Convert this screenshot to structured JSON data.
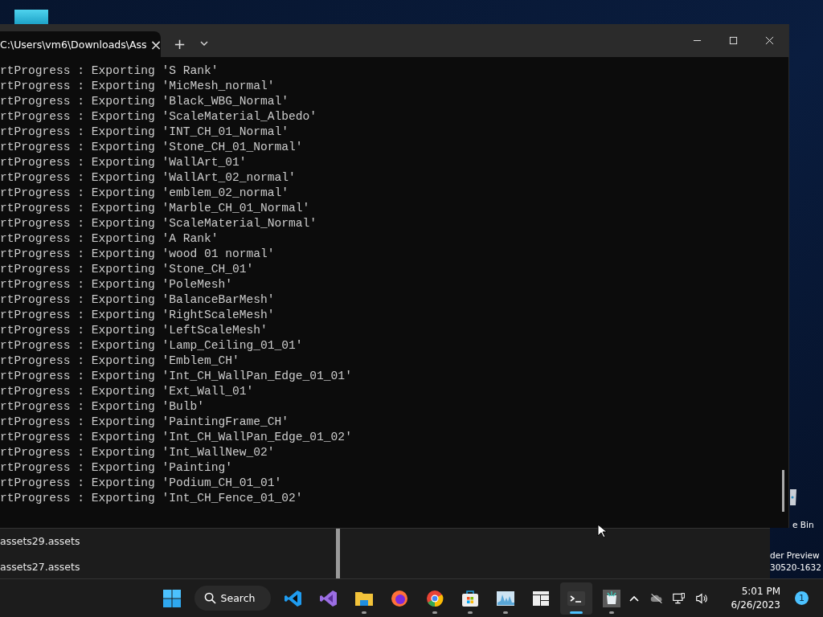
{
  "desktop": {
    "labels": [
      {
        "text": "e Bin"
      },
      {
        "text": "der Preview"
      },
      {
        "text": "30520-1632"
      }
    ]
  },
  "terminal": {
    "tab": {
      "title": "C:\\Users\\vm6\\Downloads\\Ass",
      "close": "×"
    },
    "new_tab": "+",
    "lines": [
      "rtProgress : Exporting 'S Rank'",
      "rtProgress : Exporting 'MicMesh_normal'",
      "rtProgress : Exporting 'Black_WBG_Normal'",
      "rtProgress : Exporting 'ScaleMaterial_Albedo'",
      "rtProgress : Exporting 'INT_CH_01_Normal'",
      "rtProgress : Exporting 'Stone_CH_01_Normal'",
      "rtProgress : Exporting 'WallArt_01'",
      "rtProgress : Exporting 'WallArt_02_normal'",
      "rtProgress : Exporting 'emblem_02_normal'",
      "rtProgress : Exporting 'Marble_CH_01_Normal'",
      "rtProgress : Exporting 'ScaleMaterial_Normal'",
      "rtProgress : Exporting 'A Rank'",
      "rtProgress : Exporting 'wood 01 normal'",
      "rtProgress : Exporting 'Stone_CH_01'",
      "rtProgress : Exporting 'PoleMesh'",
      "rtProgress : Exporting 'BalanceBarMesh'",
      "rtProgress : Exporting 'RightScaleMesh'",
      "rtProgress : Exporting 'LeftScaleMesh'",
      "rtProgress : Exporting 'Lamp_Ceiling_01_01'",
      "rtProgress : Exporting 'Emblem_CH'",
      "rtProgress : Exporting 'Int_CH_WallPan_Edge_01_01'",
      "rtProgress : Exporting 'Ext_Wall_01'",
      "rtProgress : Exporting 'Bulb'",
      "rtProgress : Exporting 'PaintingFrame_CH'",
      "rtProgress : Exporting 'Int_CH_WallPan_Edge_01_02'",
      "rtProgress : Exporting 'Int_WallNew_02'",
      "rtProgress : Exporting 'Painting'",
      "rtProgress : Exporting 'Podium_CH_01_01'",
      "rtProgress : Exporting 'Int_CH_Fence_01_02'"
    ]
  },
  "explorer": {
    "files": [
      "assets29.assets",
      "assets27.assets"
    ]
  },
  "taskbar": {
    "search": "Search",
    "apps": [
      {
        "kind": "vscode",
        "running": false,
        "selected": false
      },
      {
        "kind": "studio",
        "running": false,
        "selected": false
      },
      {
        "kind": "folder",
        "running": true,
        "selected": false
      },
      {
        "kind": "firefox",
        "running": false,
        "selected": false
      },
      {
        "kind": "chrome",
        "running": true,
        "selected": false
      },
      {
        "kind": "store",
        "running": true,
        "selected": false
      },
      {
        "kind": "monitor",
        "running": true,
        "selected": false
      },
      {
        "kind": "snap",
        "running": false,
        "selected": false
      },
      {
        "kind": "terminal",
        "running": true,
        "selected": true
      },
      {
        "kind": "package",
        "running": true,
        "selected": false
      }
    ],
    "time": "5:01 PM",
    "date": "6/26/2023",
    "notifications": "1"
  }
}
